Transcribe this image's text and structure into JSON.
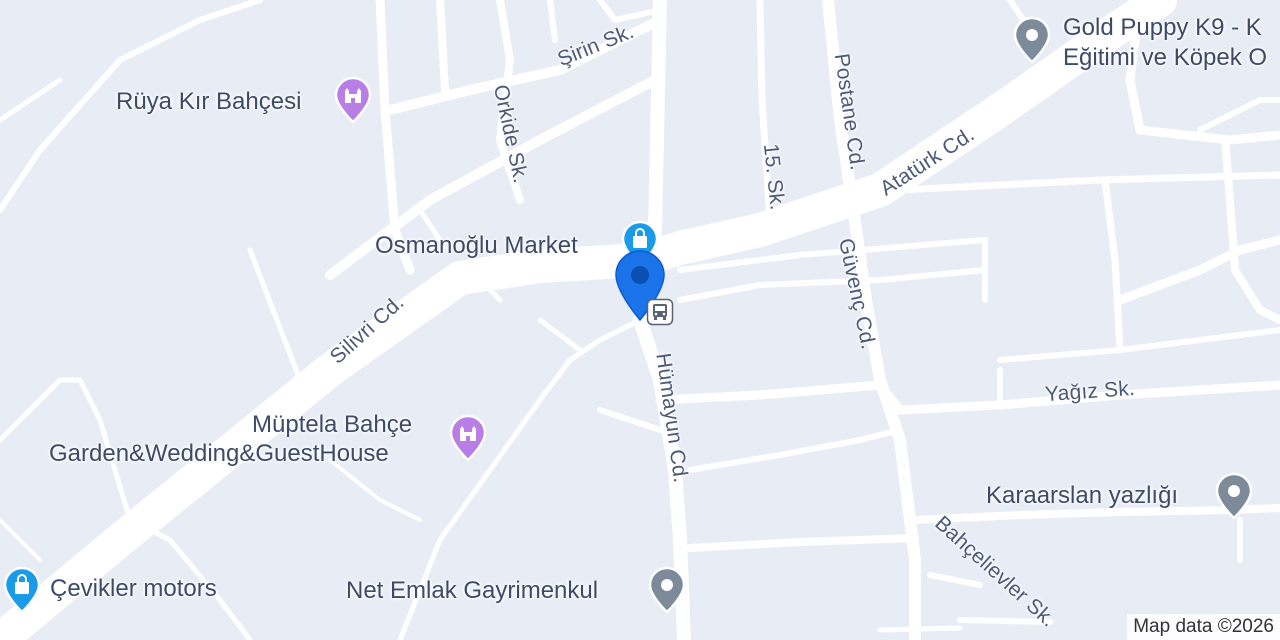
{
  "map": {
    "credit": "Map data ©2026"
  },
  "streets": {
    "sirin": "Şirin Sk.",
    "orkide": "Orkide Sk.",
    "on_bes": "15. Sk.",
    "postane": "Postane Cd.",
    "ataturk": "Atatürk Cd.",
    "silivri": "Silivri Cd.",
    "guvenc": "Güvenç Cd.",
    "humayun": "Hümayun Cd.",
    "yagiz": "Yağız Sk.",
    "bahcelievler": "Bahçelievler Sk."
  },
  "pois": {
    "gold_puppy_line1": "Gold Puppy K9 - K",
    "gold_puppy_line2": "Eğitimi ve Köpek O",
    "ruya": "Rüya Kır Bahçesi",
    "osmanoglu": "Osmanoğlu Market",
    "muptela_line1": "Müptela Bahçe",
    "muptela_line2": "Garden&Wedding&GuestHouse",
    "karaarslan": "Karaarslan yazlığı",
    "cevikler": "Çevikler motors",
    "net_emlak": "Net Emlak Gayrimenkul"
  },
  "colors": {
    "background": "#e8ecf5",
    "road": "#ffffff",
    "wedding_poi": "#b97ee6",
    "shop_poi": "#1a9be8",
    "generic_poi": "#7c8a9a",
    "location_pin": "#1a73e8"
  },
  "icons": {
    "wedding": "wedding-venue-icon",
    "shop": "shopping-bag-icon",
    "generic": "generic-place-icon",
    "bus": "bus-stop-icon",
    "location": "location-pin-icon"
  }
}
